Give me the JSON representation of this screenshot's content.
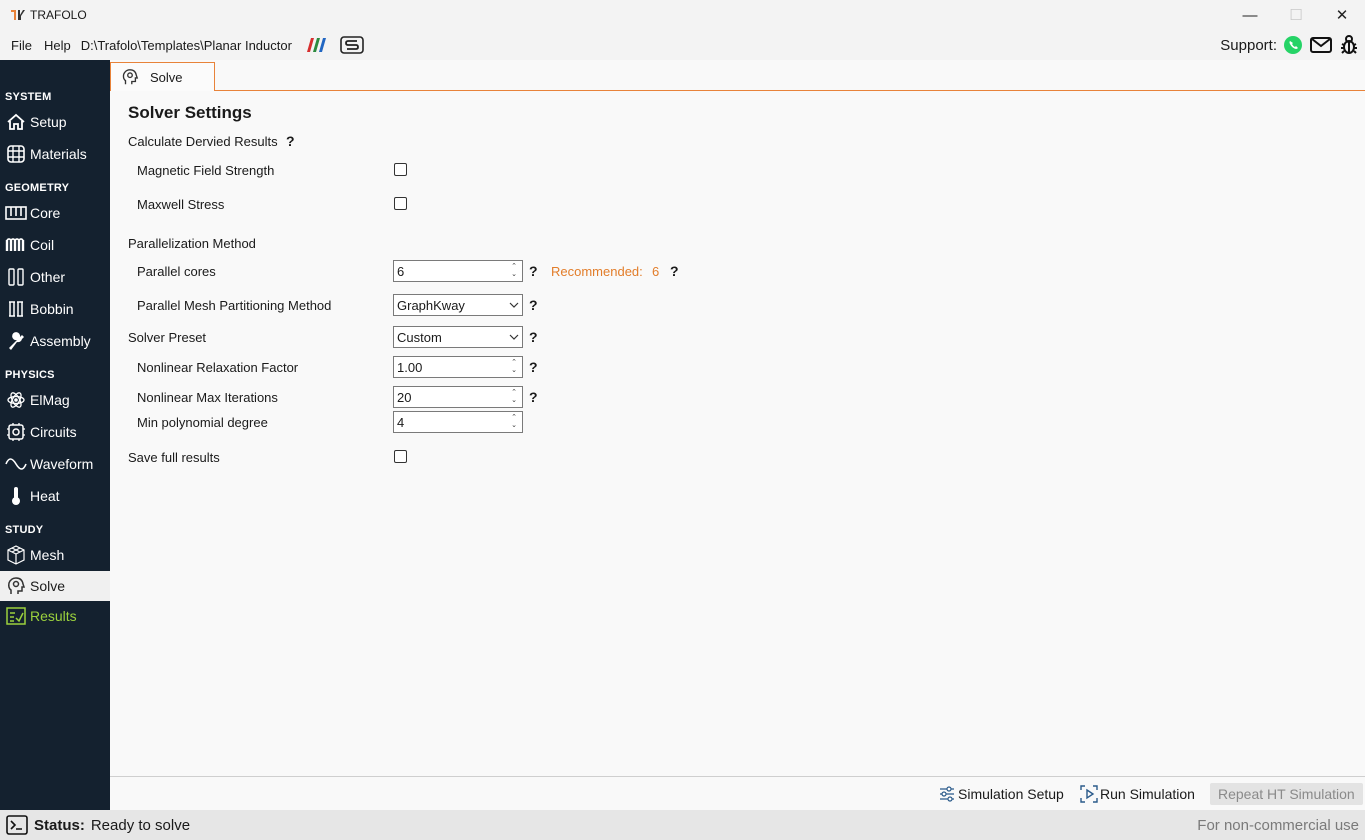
{
  "window": {
    "title": "TRAFOLO",
    "controls": {
      "minimize": "—",
      "maximize": "☐",
      "close": "✕"
    }
  },
  "menu": {
    "items": [
      "File",
      "Help"
    ],
    "path": "D:\\Trafolo\\Templates\\Planar Inductor",
    "support_label": "Support:"
  },
  "sidebar": {
    "sections": {
      "system": "SYSTEM",
      "geometry": "GEOMETRY",
      "physics": "PHYSICS",
      "study": "STUDY"
    },
    "items": {
      "setup": "Setup",
      "materials": "Materials",
      "core": "Core",
      "coil": "Coil",
      "other": "Other",
      "bobbin": "Bobbin",
      "assembly": "Assembly",
      "elmag": "ElMag",
      "circuits": "Circuits",
      "waveform": "Waveform",
      "heat": "Heat",
      "mesh": "Mesh",
      "solve": "Solve",
      "results": "Results"
    },
    "active": "Solve"
  },
  "tabs": [
    {
      "label": "Solve"
    }
  ],
  "solver": {
    "title": "Solver Settings",
    "derived_results_label": "Calculate Dervied Results",
    "magnetic_field_strength": {
      "label": "Magnetic Field Strength",
      "checked": false
    },
    "maxwell_stress": {
      "label": "Maxwell Stress",
      "checked": false
    },
    "parallelization_label": "Parallelization Method",
    "parallel_cores": {
      "label": "Parallel cores",
      "value": "6"
    },
    "recommended": {
      "label": "Recommended:",
      "value": "6"
    },
    "partitioning": {
      "label": "Parallel Mesh Partitioning Method",
      "value": "GraphKway"
    },
    "preset": {
      "label": "Solver Preset",
      "value": "Custom"
    },
    "relaxation": {
      "label": "Nonlinear Relaxation Factor",
      "value": "1.00"
    },
    "max_iterations": {
      "label": "Nonlinear Max Iterations",
      "value": "20"
    },
    "min_poly_degree": {
      "label": "Min polynomial degree",
      "value": "4"
    },
    "save_full_results": {
      "label": "Save full results",
      "checked": false
    },
    "help_glyph": "?"
  },
  "actions": {
    "simulation_setup": "Simulation Setup",
    "run_simulation": "Run Simulation",
    "repeat_ht": "Repeat HT Simulation"
  },
  "status": {
    "key": "Status:",
    "value": "Ready to solve",
    "license": "For non-commercial use"
  },
  "colors": {
    "sidebar_bg": "#14212f",
    "accent_orange": "#e8833a",
    "results_green": "#9bd13d",
    "recommended_orange": "#e27d2a"
  }
}
